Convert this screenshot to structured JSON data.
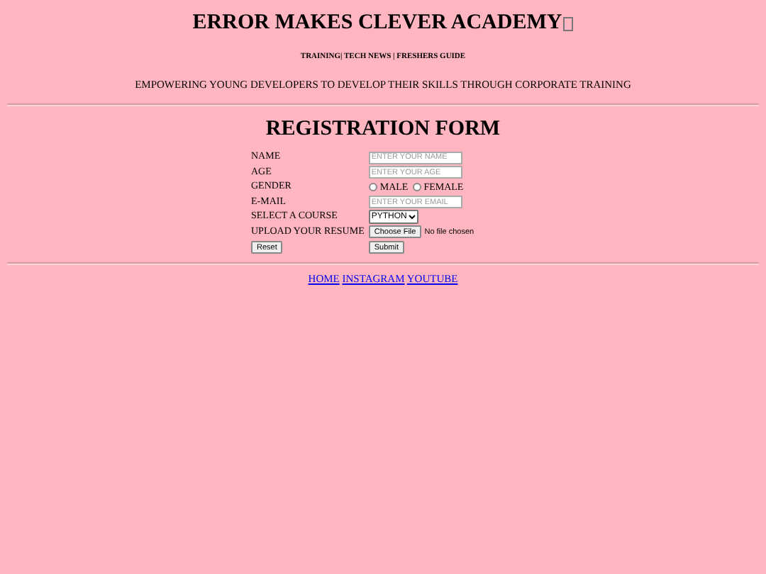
{
  "header": {
    "title": "ERROR MAKES CLEVER ACADEMY",
    "nav": "TRAINING| TECH NEWS | FRESHERS GUIDE",
    "tagline": "EMPOWERING YOUNG DEVELOPERS TO DEVELOP THEIR SKILLS THROUGH CORPORATE TRAINING"
  },
  "form": {
    "title": "REGISTRATION FORM",
    "fields": [
      {
        "kind": "text",
        "label": "NAME",
        "placeholder": "ENTER YOUR NAME"
      },
      {
        "kind": "text",
        "label": "AGE",
        "placeholder": "ENTER YOUR AGE"
      },
      {
        "kind": "radio",
        "label": "GENDER",
        "options": [
          {
            "label": "MALE",
            "selected": false
          },
          {
            "label": "FEMALE",
            "selected": false
          }
        ]
      },
      {
        "kind": "text",
        "label": "E-MAIL",
        "placeholder": "ENTER YOUR EMAIL"
      },
      {
        "kind": "select",
        "label": "SELECT A COURSE",
        "value": "PYTHON"
      },
      {
        "kind": "file",
        "label": "UPLOAD YOUR RESUME",
        "button": "Choose File",
        "status": "No file chosen"
      }
    ],
    "buttons": [
      "Reset",
      "Submit"
    ]
  },
  "footer_links": [
    "HOME",
    "INSTAGRAM",
    "YOUTUBE"
  ]
}
